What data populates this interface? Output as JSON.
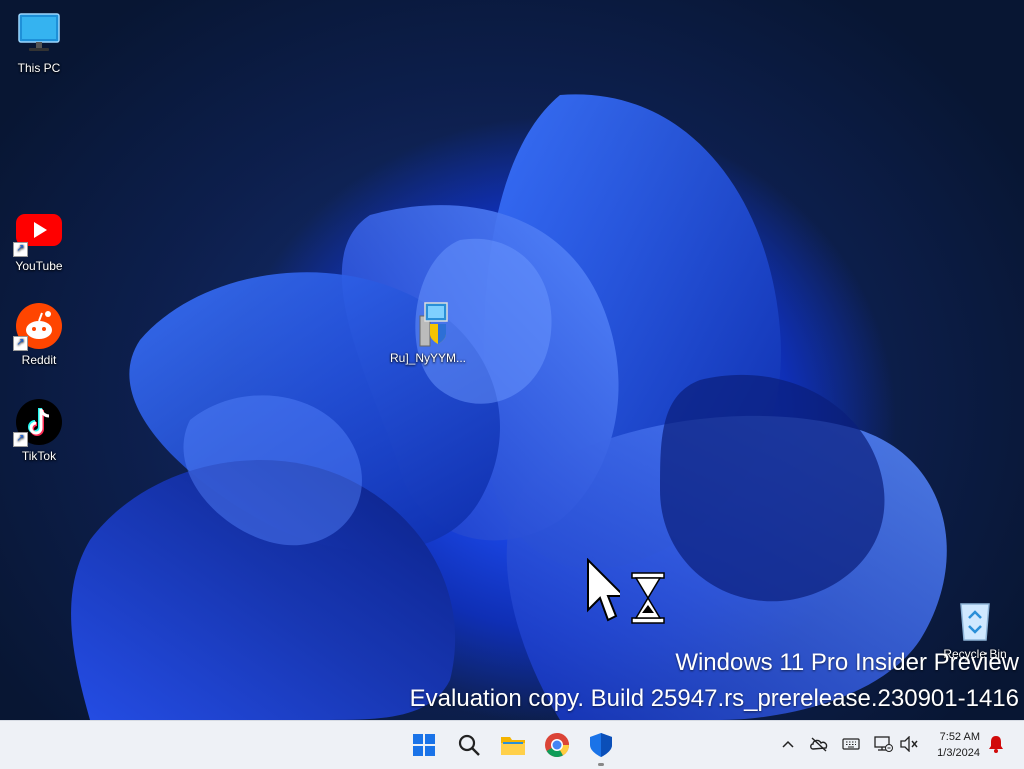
{
  "desktop": {
    "icons": {
      "this_pc": {
        "label": "This PC",
        "icon": "monitor-icon"
      },
      "youtube": {
        "label": "YouTube",
        "icon": "youtube-icon"
      },
      "reddit": {
        "label": "Reddit",
        "icon": "reddit-icon"
      },
      "tiktok": {
        "label": "TikTok",
        "icon": "tiktok-icon"
      },
      "installer": {
        "label": "Ru]_NyYYM...",
        "icon": "installer-icon"
      },
      "recycle_bin": {
        "label": "Recycle Bin",
        "icon": "recycle-bin-icon"
      }
    },
    "watermark": {
      "line1": "Windows 11 Pro Insider Preview",
      "line2": "Evaluation copy. Build 25947.rs_prerelease.230901-1416"
    }
  },
  "taskbar": {
    "pinned": [
      "start-icon",
      "search-icon",
      "file-explorer-icon",
      "chrome-icon",
      "defender-icon"
    ],
    "tray": [
      "chevron-up-icon",
      "onedrive-offline-icon",
      "keyboard-icon",
      "network-icon",
      "volume-muted-icon",
      "notification-bell-icon"
    ],
    "clock": {
      "time": "7:52 AM",
      "date": "1/3/2024"
    }
  },
  "colors": {
    "accent": "#1b47e6",
    "taskbar": "#eef1f6",
    "youtube_red": "#ff0000",
    "reddit_orange": "#ff4500"
  }
}
